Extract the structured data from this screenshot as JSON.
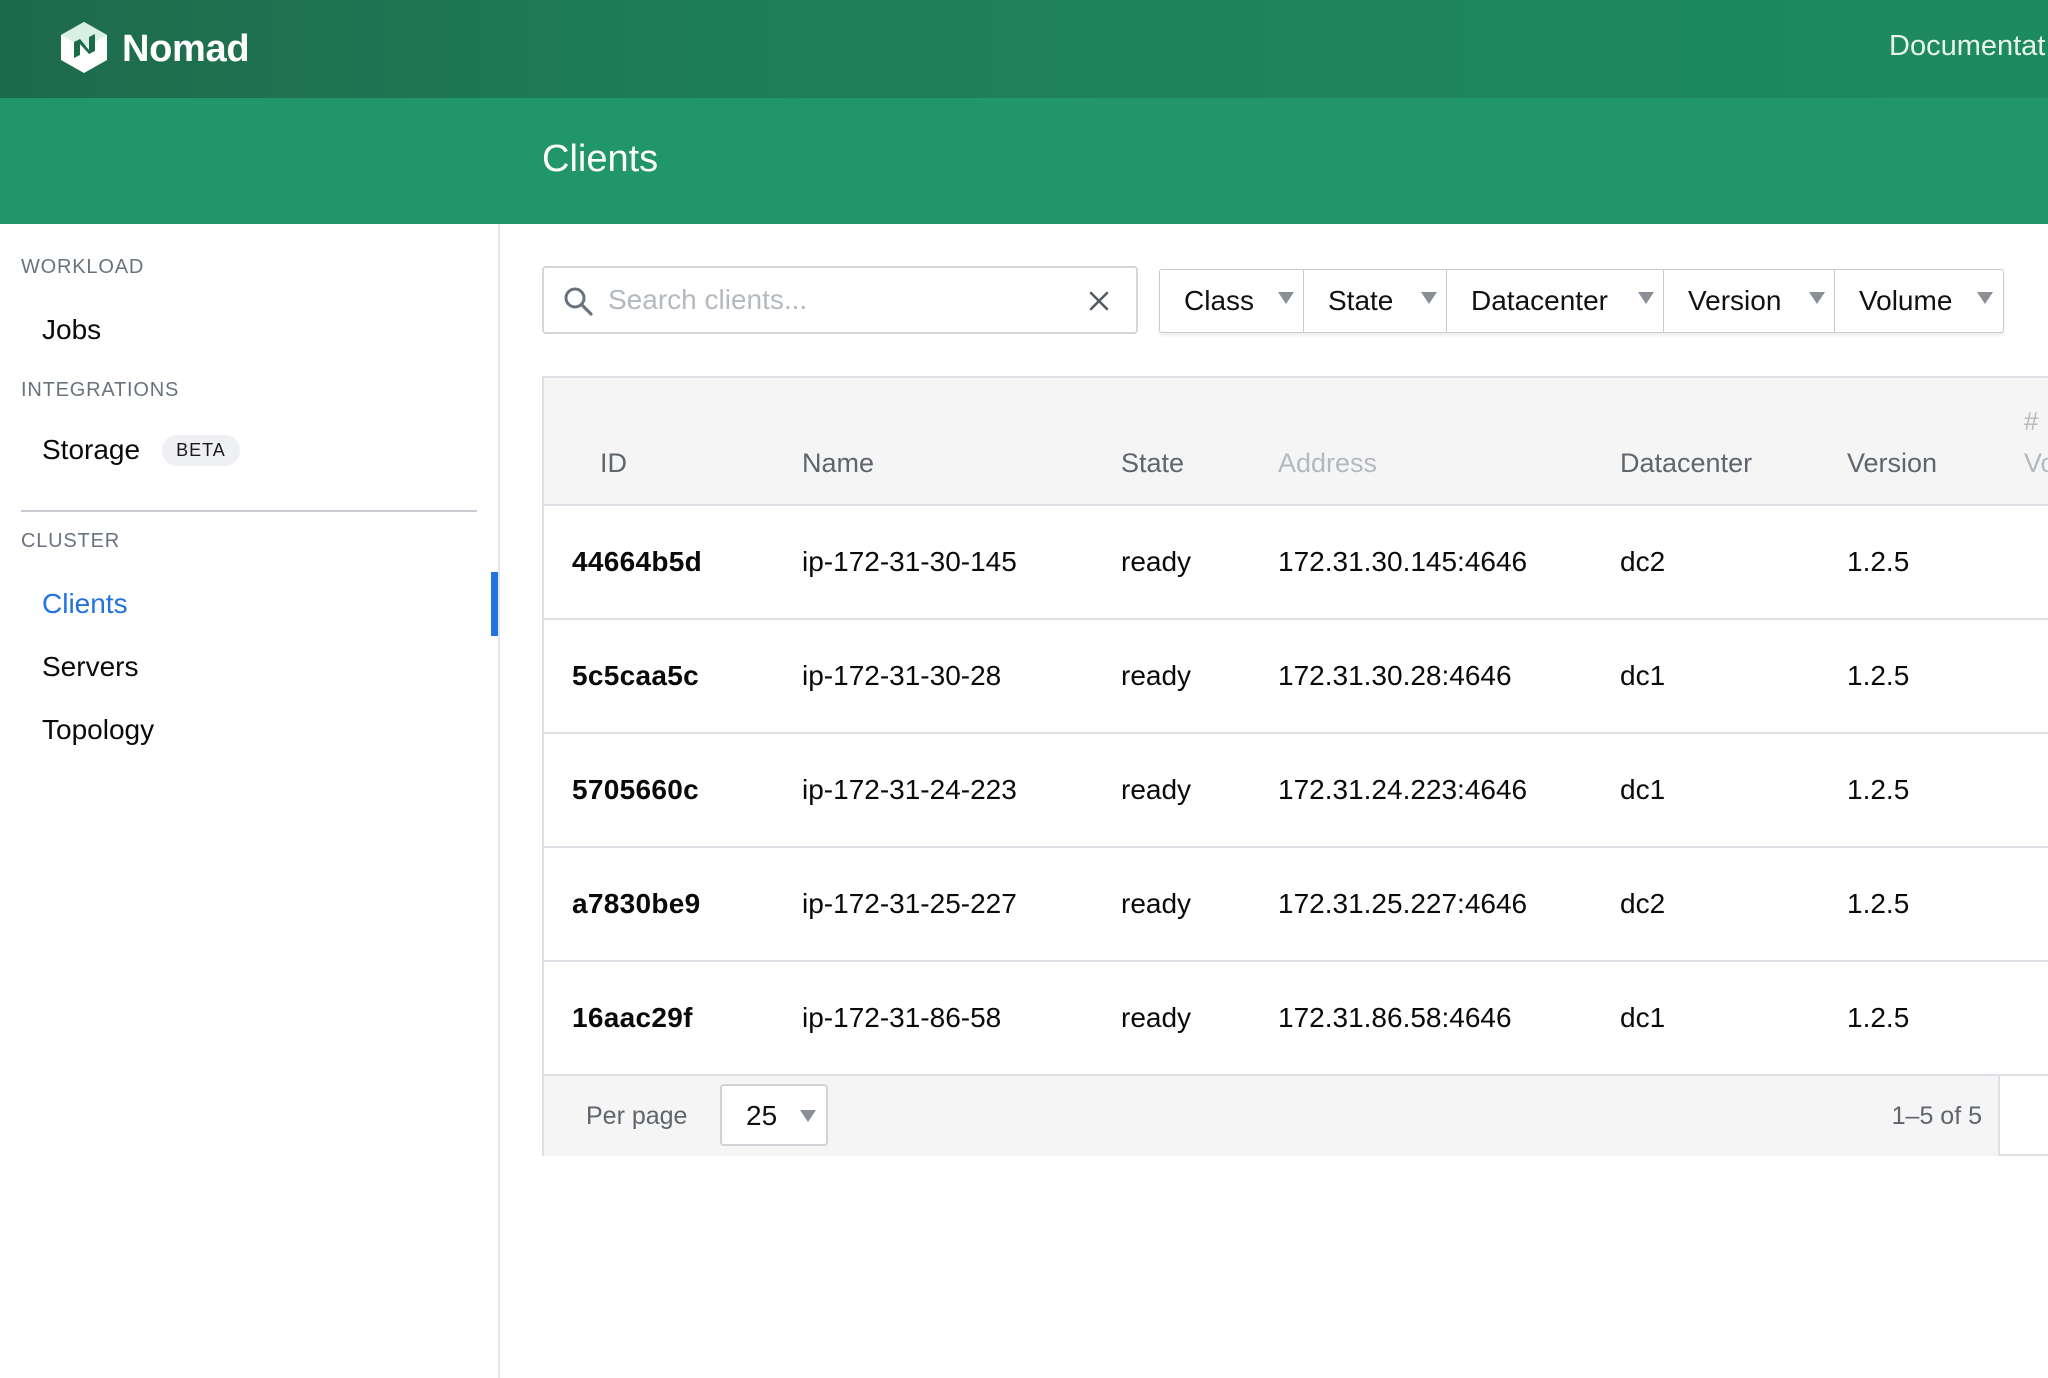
{
  "topbar": {
    "brand": "Nomad",
    "doc_link": "Documentat",
    "colors": {
      "dark": "#1e6a4c",
      "light": "#1e8b5f"
    }
  },
  "header": {
    "title": "Clients",
    "color": "#21966a"
  },
  "sidebar": {
    "sections": [
      {
        "label": "WORKLOAD"
      },
      {
        "label": "INTEGRATIONS"
      },
      {
        "label": "CLUSTER"
      }
    ],
    "items": [
      {
        "label": "Jobs"
      },
      {
        "label": "Storage",
        "badge": "BETA"
      },
      {
        "label": "Clients",
        "active": true
      },
      {
        "label": "Servers"
      },
      {
        "label": "Topology"
      }
    ],
    "active_color": "#2272e0"
  },
  "search": {
    "placeholder": "Search clients...",
    "value": ""
  },
  "filters": [
    {
      "label": "Class"
    },
    {
      "label": "State"
    },
    {
      "label": "Datacenter"
    },
    {
      "label": "Version"
    },
    {
      "label": "Volume"
    }
  ],
  "table": {
    "columns": [
      "ID",
      "Name",
      "State",
      "Address",
      "Datacenter",
      "Version",
      "#",
      "Vo"
    ],
    "rows": [
      {
        "id": "44664b5d",
        "name": "ip-172-31-30-145",
        "state": "ready",
        "address": "172.31.30.145:4646",
        "datacenter": "dc2",
        "version": "1.2.5"
      },
      {
        "id": "5c5caa5c",
        "name": "ip-172-31-30-28",
        "state": "ready",
        "address": "172.31.30.28:4646",
        "datacenter": "dc1",
        "version": "1.2.5"
      },
      {
        "id": "5705660c",
        "name": "ip-172-31-24-223",
        "state": "ready",
        "address": "172.31.24.223:4646",
        "datacenter": "dc1",
        "version": "1.2.5"
      },
      {
        "id": "a7830be9",
        "name": "ip-172-31-25-227",
        "state": "ready",
        "address": "172.31.25.227:4646",
        "datacenter": "dc2",
        "version": "1.2.5"
      },
      {
        "id": "16aac29f",
        "name": "ip-172-31-86-58",
        "state": "ready",
        "address": "172.31.86.58:4646",
        "datacenter": "dc1",
        "version": "1.2.5"
      }
    ]
  },
  "pagination": {
    "per_page_label": "Per page",
    "per_page_value": "25",
    "range": "1–5 of 5"
  }
}
